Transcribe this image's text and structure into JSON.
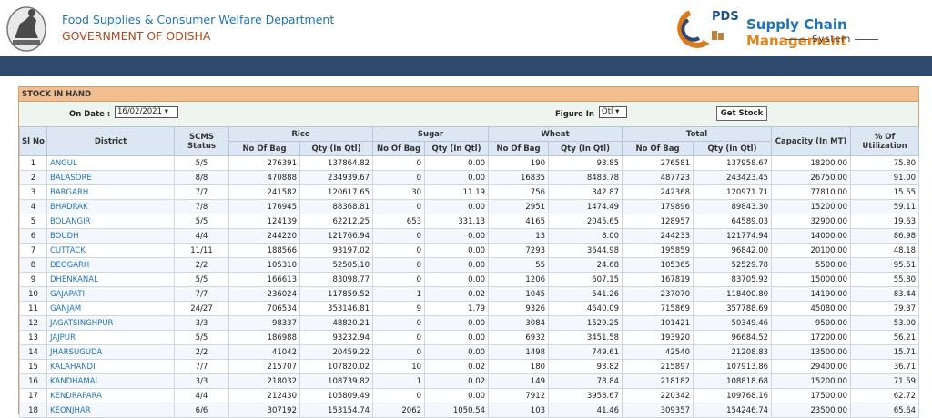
{
  "header": {
    "department": "Food Supplies & Consumer Welfare Department",
    "government": "GOVERNMENT OF ODISHA",
    "pds": "PDS",
    "brand_main": "Supply Chain ",
    "brand_accent": "Management",
    "brand_sub": "System"
  },
  "panel": {
    "title": "STOCK IN HAND",
    "on_date_label": "On Date :",
    "on_date_value": "16/02/2021 ▾",
    "figure_in_label": "Figure In",
    "figure_in_value": "Qtl ▾",
    "get_stock_label": "Get Stock"
  },
  "table": {
    "headers": {
      "slno": "Sl No",
      "district": "District",
      "scms": "SCMS Status",
      "rice": "Rice",
      "sugar": "Sugar",
      "wheat": "Wheat",
      "total": "Total",
      "capacity": "Capacity (In MT)",
      "util": "% Of Utilization",
      "no_of_bag": "No Of Bag",
      "qty_qtl": "Qty (In Qtl)"
    },
    "rows": [
      [
        "1",
        "ANGUL",
        "5/5",
        "276391",
        "137864.82",
        "0",
        "0.00",
        "190",
        "93.85",
        "276581",
        "137958.67",
        "18200.00",
        "75.80"
      ],
      [
        "2",
        "BALASORE",
        "8/8",
        "470888",
        "234939.67",
        "0",
        "0.00",
        "16835",
        "8483.78",
        "487723",
        "243423.45",
        "26750.00",
        "91.00"
      ],
      [
        "3",
        "BARGARH",
        "7/7",
        "241582",
        "120617.65",
        "30",
        "11.19",
        "756",
        "342.87",
        "242368",
        "120971.71",
        "77810.00",
        "15.55"
      ],
      [
        "4",
        "BHADRAK",
        "7/8",
        "176945",
        "88368.81",
        "0",
        "0.00",
        "2951",
        "1474.49",
        "179896",
        "89843.30",
        "15200.00",
        "59.11"
      ],
      [
        "5",
        "BOLANGIR",
        "5/5",
        "124139",
        "62212.25",
        "653",
        "331.13",
        "4165",
        "2045.65",
        "128957",
        "64589.03",
        "32900.00",
        "19.63"
      ],
      [
        "6",
        "BOUDH",
        "4/4",
        "244220",
        "121766.94",
        "0",
        "0.00",
        "13",
        "8.00",
        "244233",
        "121774.94",
        "14000.00",
        "86.98"
      ],
      [
        "7",
        "CUTTACK",
        "11/11",
        "188566",
        "93197.02",
        "0",
        "0.00",
        "7293",
        "3644.98",
        "195859",
        "96842.00",
        "20100.00",
        "48.18"
      ],
      [
        "8",
        "DEOGARH",
        "2/2",
        "105310",
        "52505.10",
        "0",
        "0.00",
        "55",
        "24.68",
        "105365",
        "52529.78",
        "5500.00",
        "95.51"
      ],
      [
        "9",
        "DHENKANAL",
        "5/5",
        "166613",
        "83098.77",
        "0",
        "0.00",
        "1206",
        "607.15",
        "167819",
        "83705.92",
        "15000.00",
        "55.80"
      ],
      [
        "10",
        "GAJAPATI",
        "7/7",
        "236024",
        "117859.52",
        "1",
        "0.02",
        "1045",
        "541.26",
        "237070",
        "118400.80",
        "14190.00",
        "83.44"
      ],
      [
        "11",
        "GANJAM",
        "24/27",
        "706534",
        "353146.81",
        "9",
        "1.79",
        "9326",
        "4640.09",
        "715869",
        "357788.69",
        "45080.00",
        "79.37"
      ],
      [
        "12",
        "JAGATSINGHPUR",
        "3/3",
        "98337",
        "48820.21",
        "0",
        "0.00",
        "3084",
        "1529.25",
        "101421",
        "50349.46",
        "9500.00",
        "53.00"
      ],
      [
        "13",
        "JAJPUR",
        "5/5",
        "186988",
        "93232.94",
        "0",
        "0.00",
        "6932",
        "3451.58",
        "193920",
        "96684.52",
        "17200.00",
        "56.21"
      ],
      [
        "14",
        "JHARSUGUDA",
        "2/2",
        "41042",
        "20459.22",
        "0",
        "0.00",
        "1498",
        "749.61",
        "42540",
        "21208.83",
        "13500.00",
        "15.71"
      ],
      [
        "15",
        "KALAHANDI",
        "7/7",
        "215707",
        "107820.02",
        "10",
        "0.02",
        "180",
        "93.82",
        "215897",
        "107913.86",
        "29400.00",
        "36.71"
      ],
      [
        "16",
        "KANDHAMAL",
        "3/3",
        "218032",
        "108739.82",
        "1",
        "0.02",
        "149",
        "78.84",
        "218182",
        "108818.68",
        "15200.00",
        "71.59"
      ],
      [
        "17",
        "KENDRAPARA",
        "4/4",
        "212430",
        "105809.49",
        "0",
        "0.00",
        "7912",
        "3958.67",
        "220342",
        "109768.16",
        "17500.00",
        "62.72"
      ],
      [
        "18",
        "KEONJHAR",
        "6/6",
        "307192",
        "153154.74",
        "2062",
        "1050.54",
        "103",
        "41.46",
        "309357",
        "154246.74",
        "23500.00",
        "65.64"
      ]
    ]
  }
}
